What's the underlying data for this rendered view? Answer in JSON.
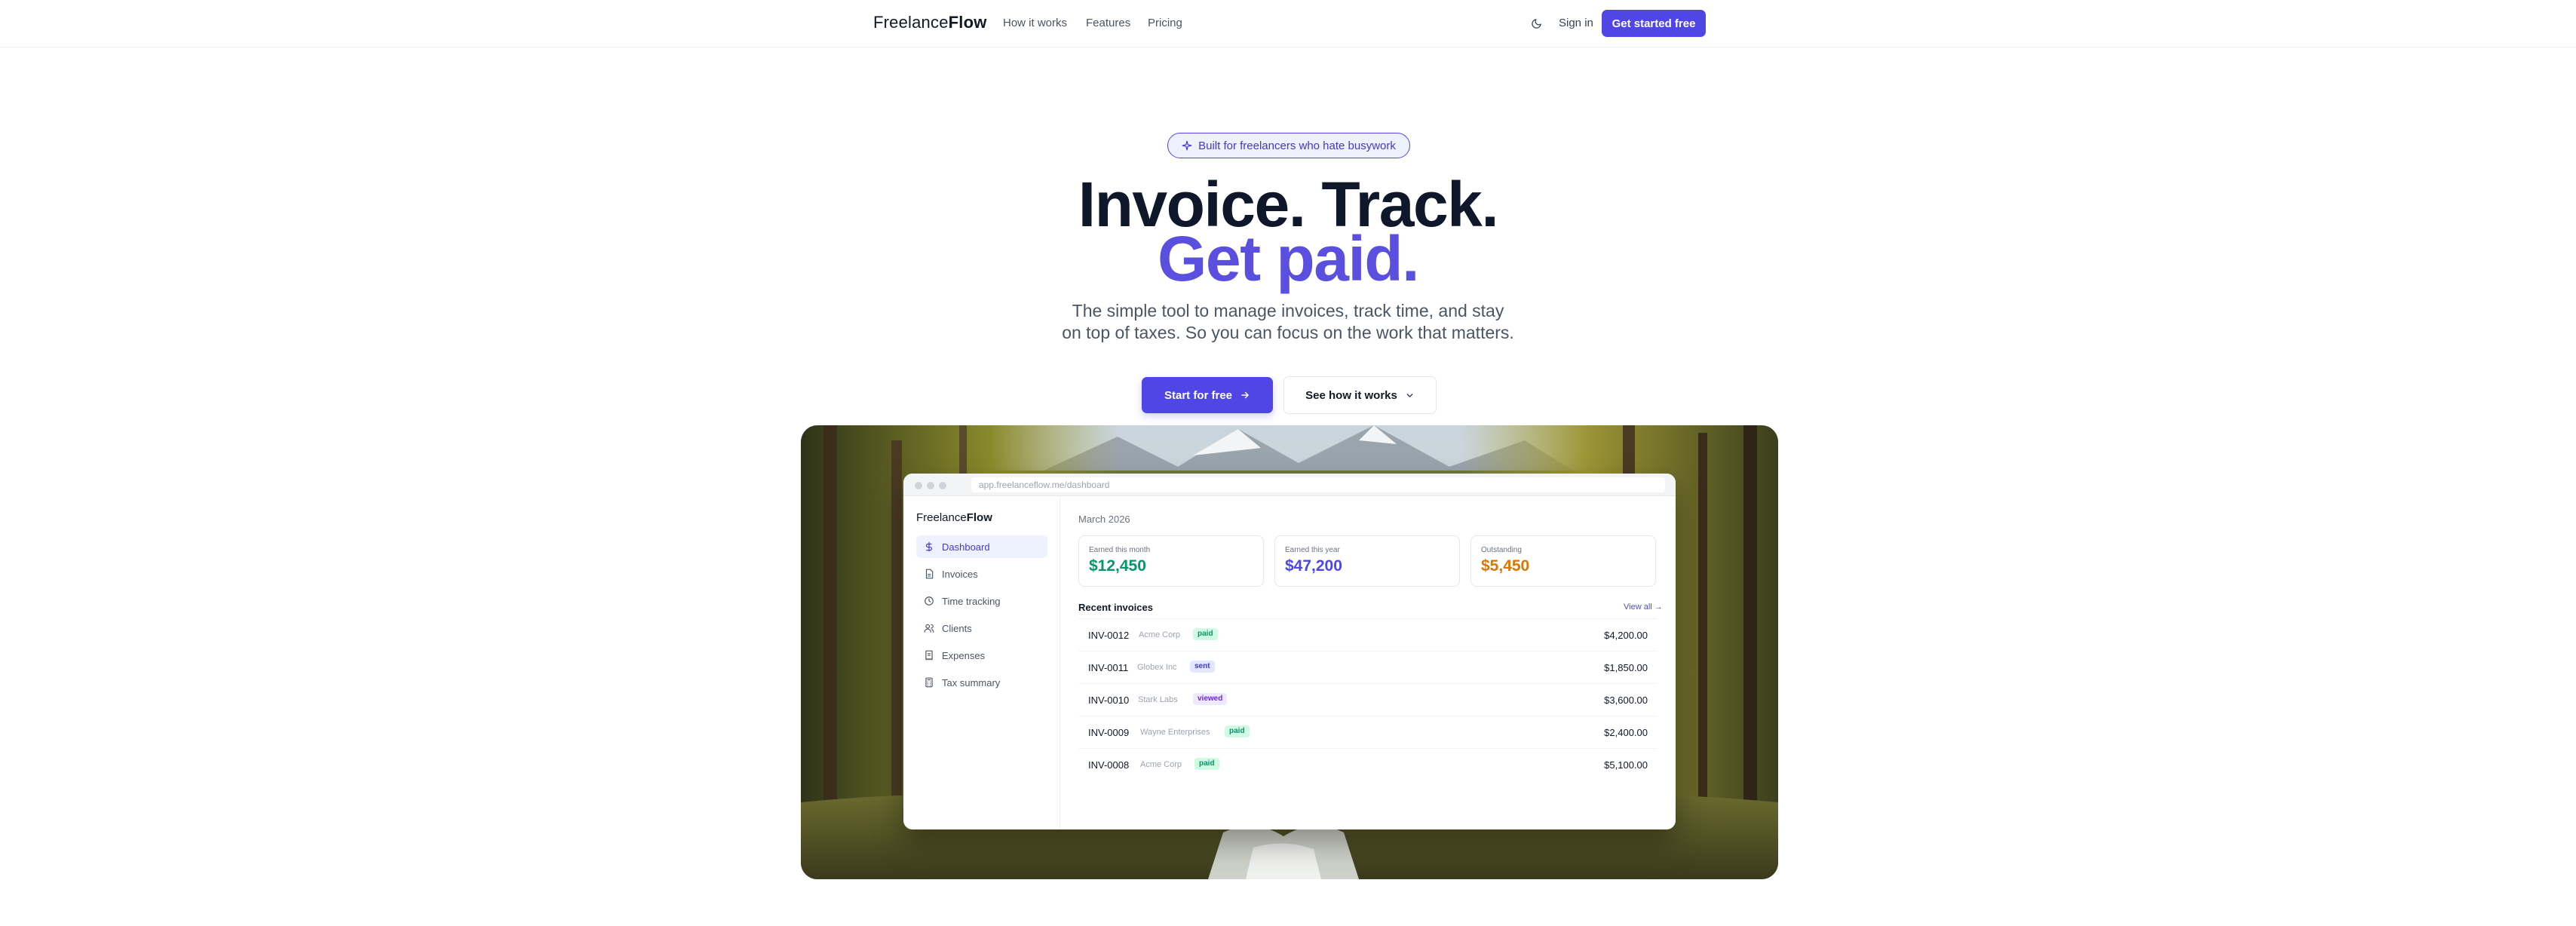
{
  "nav": {
    "logo_light": "Freelance",
    "logo_bold": "Flow",
    "links": [
      "How it works",
      "Features",
      "Pricing"
    ],
    "signin": "Sign in",
    "cta": "Get started free"
  },
  "hero": {
    "pill": "Built for freelancers who hate busywork",
    "headline_1": "Invoice. Track.",
    "headline_2": "Get paid.",
    "subtitle": "The simple tool to manage invoices, track time, and stay on top of taxes. So you can focus on the work that matters.",
    "primary_button": "Start for free",
    "secondary_button": "See how it works"
  },
  "dashboard": {
    "url": "app.freelanceflow.me/dashboard",
    "logo_light": "Freelance",
    "logo_bold": "Flow",
    "sidebar": [
      {
        "label": "Dashboard",
        "icon": "dollar-icon",
        "active": true
      },
      {
        "label": "Invoices",
        "icon": "document-icon",
        "active": false
      },
      {
        "label": "Time tracking",
        "icon": "clock-icon",
        "active": false
      },
      {
        "label": "Clients",
        "icon": "users-icon",
        "active": false
      },
      {
        "label": "Expenses",
        "icon": "receipt-icon",
        "active": false
      },
      {
        "label": "Tax summary",
        "icon": "calculator-icon",
        "active": false
      }
    ],
    "period": "March 2026",
    "stats": [
      {
        "label": "Earned this month",
        "value": "$12,450",
        "color": "#059669"
      },
      {
        "label": "Earned this year",
        "value": "$47,200",
        "color": "#4f46e5"
      },
      {
        "label": "Outstanding",
        "value": "$5,450",
        "color": "#d97706"
      }
    ],
    "recent_title": "Recent invoices",
    "view_all": "View all →",
    "invoices": [
      {
        "id": "INV-0012",
        "client": "Acme Corp",
        "status": "paid",
        "amount": "$4,200.00"
      },
      {
        "id": "INV-0011",
        "client": "Globex Inc",
        "status": "sent",
        "amount": "$1,850.00"
      },
      {
        "id": "INV-0010",
        "client": "Stark Labs",
        "status": "viewed",
        "amount": "$3,600.00"
      },
      {
        "id": "INV-0009",
        "client": "Wayne Enterprises",
        "status": "paid",
        "amount": "$2,400.00"
      },
      {
        "id": "INV-0008",
        "client": "Acme Corp",
        "status": "paid",
        "amount": "$5,100.00"
      }
    ]
  },
  "colors": {
    "accent": "#4f46e5",
    "paid_bg": "#d1fae5",
    "paid_fg": "#059669",
    "sent_bg": "#e0e7ff",
    "sent_fg": "#4338ca",
    "viewed_bg": "#ede9fe",
    "viewed_fg": "#6d28d9"
  }
}
